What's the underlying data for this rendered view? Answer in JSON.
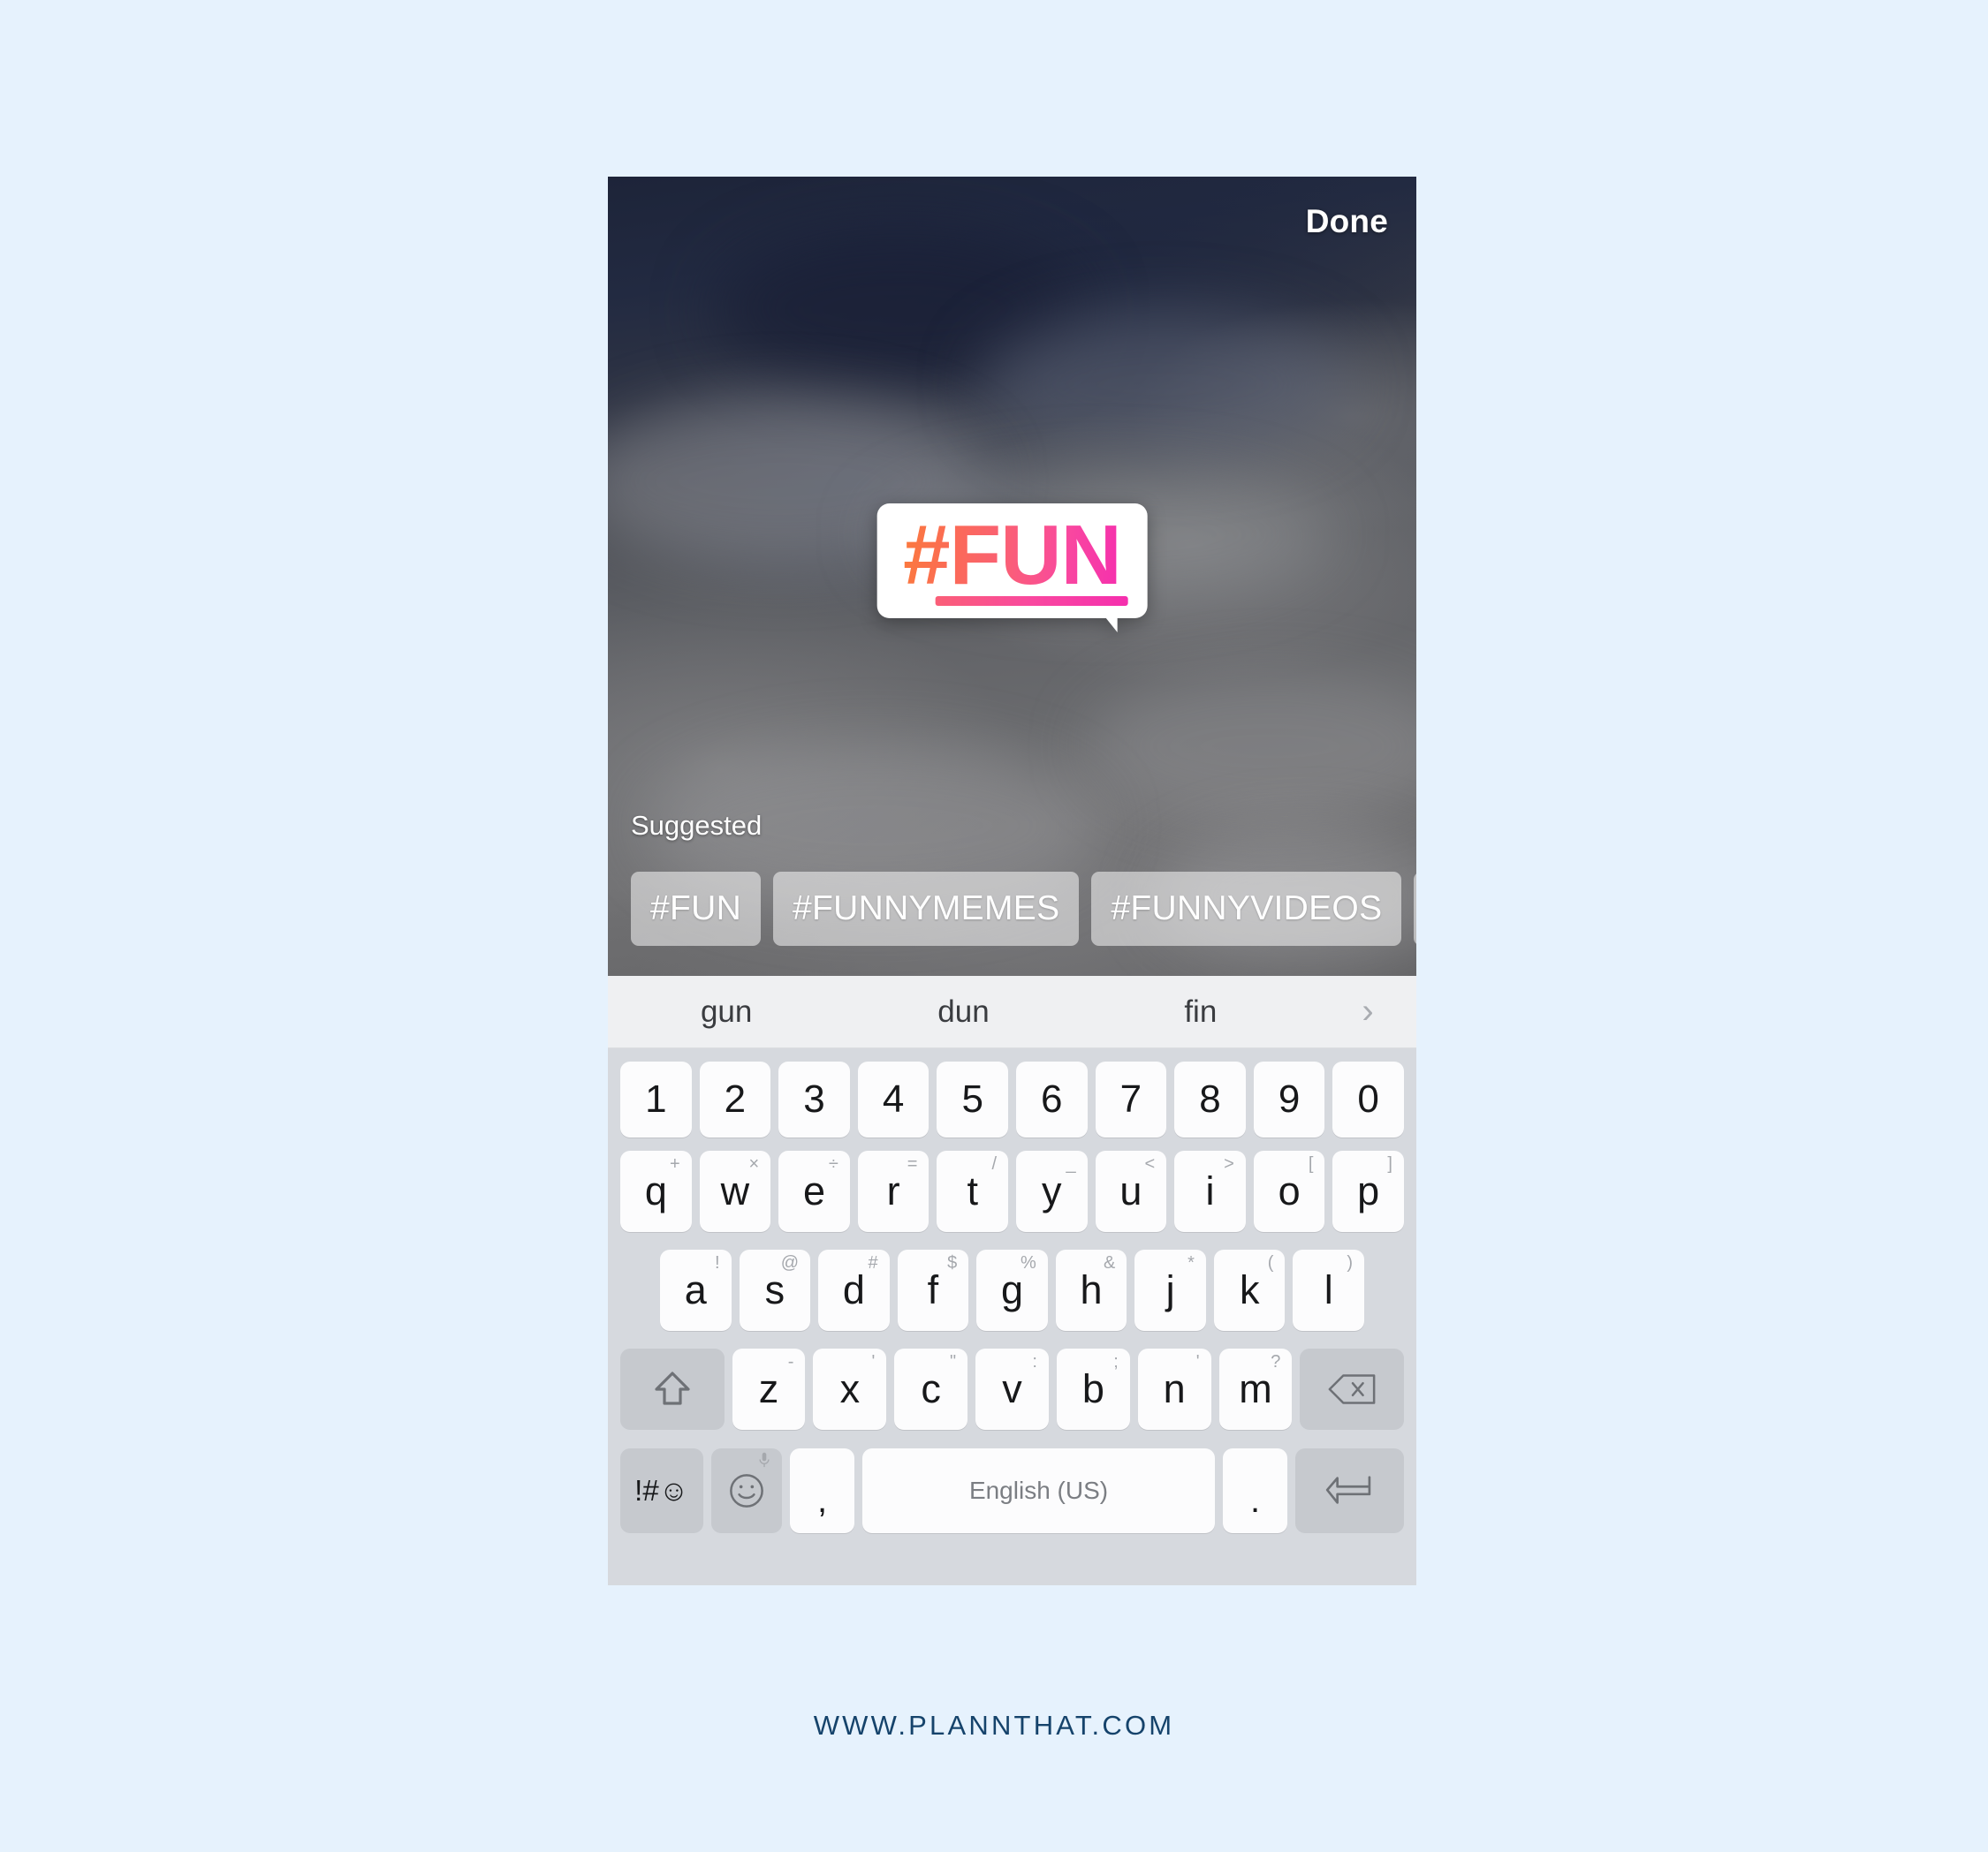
{
  "theme": {
    "page_background": "#e6f2fd",
    "accent_pink": "#f52fae",
    "accent_orange": "#fb7a3d",
    "footer_color": "#15436b",
    "keyboard_background": "#d6d9de",
    "key_background": "#fcfcfd"
  },
  "story": {
    "done_label": "Done",
    "sticker": {
      "hash_symbol": "#",
      "text": "FUN",
      "full_text": "#FUN"
    },
    "suggested_label": "Suggested",
    "suggested_chips": [
      {
        "label": "#FUN"
      },
      {
        "label": "#FUNNYMEMES"
      },
      {
        "label": "#FUNNYVIDEOS"
      },
      {
        "label": "#"
      }
    ]
  },
  "keyboard": {
    "suggestions": [
      "gun",
      "dun",
      "fin"
    ],
    "more_suggestions_icon": "chevron-right-icon",
    "number_row": [
      "1",
      "2",
      "3",
      "4",
      "5",
      "6",
      "7",
      "8",
      "9",
      "0"
    ],
    "row_qwerty": [
      {
        "key": "q",
        "sup": "+"
      },
      {
        "key": "w",
        "sup": "×"
      },
      {
        "key": "e",
        "sup": "÷"
      },
      {
        "key": "r",
        "sup": "="
      },
      {
        "key": "t",
        "sup": "/"
      },
      {
        "key": "y",
        "sup": "_"
      },
      {
        "key": "u",
        "sup": "<"
      },
      {
        "key": "i",
        "sup": ">"
      },
      {
        "key": "o",
        "sup": "["
      },
      {
        "key": "p",
        "sup": "]"
      }
    ],
    "row_asdf": [
      {
        "key": "a",
        "sup": "!"
      },
      {
        "key": "s",
        "sup": "@"
      },
      {
        "key": "d",
        "sup": "#"
      },
      {
        "key": "f",
        "sup": "$"
      },
      {
        "key": "g",
        "sup": "%"
      },
      {
        "key": "h",
        "sup": "&"
      },
      {
        "key": "j",
        "sup": "*"
      },
      {
        "key": "k",
        "sup": "("
      },
      {
        "key": "l",
        "sup": ")"
      }
    ],
    "row_zxcv": [
      {
        "key": "z",
        "sup": "-"
      },
      {
        "key": "x",
        "sup": "'"
      },
      {
        "key": "c",
        "sup": "\""
      },
      {
        "key": "v",
        "sup": ":"
      },
      {
        "key": "b",
        "sup": ";"
      },
      {
        "key": "n",
        "sup": "'"
      },
      {
        "key": "m",
        "sup": "?"
      }
    ],
    "shift_icon": "shift-arrow-icon",
    "backspace_icon": "backspace-icon",
    "symbols_label": "!#☺",
    "emoji_icon": "emoji-face-icon",
    "emoji_sup_icon": "microphone-icon",
    "comma_label": ",",
    "space_label": "English (US)",
    "period_label": ".",
    "enter_icon": "enter-return-icon"
  },
  "footer": {
    "url": "WWW.PLANNTHAT.COM"
  }
}
